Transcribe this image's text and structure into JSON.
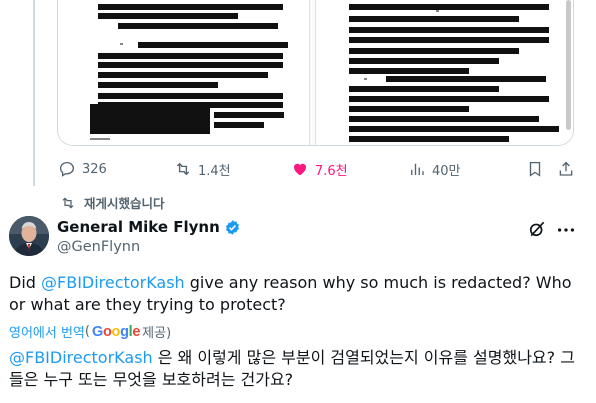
{
  "stats": {
    "replies": "326",
    "reposts": "1.4천",
    "likes": "7.6천",
    "views": "40만"
  },
  "repost_banner": "재게시했습니다",
  "author": {
    "name": "General Mike Flynn",
    "handle": "@GenFlynn"
  },
  "tweet": {
    "mention": "@FBIDirectorKash",
    "before_mention": "Did ",
    "after_mention": " give any reason why so much is redacted? Who or what are they trying to protect?"
  },
  "translation": {
    "link_label": "영어에서 번역",
    "open_paren": "(",
    "provider": "Google",
    "provided_by": " 제공)",
    "mention": "@FBIDirectorKash",
    "text": " 은 왜 이렇게 많은 부분이 검열되었는지 이유를 설명했나요? 그들은 누구 또는 무엇을 보호하려는 건가요?"
  },
  "colors": {
    "accent": "#1d9bf0",
    "like": "#f91880",
    "muted": "#536471",
    "verified": "#1d9bf0"
  },
  "icons": [
    "reply-icon",
    "repost-icon",
    "heart-icon",
    "views-icon",
    "bookmark-icon",
    "share-icon",
    "grok-icon",
    "more-icon",
    "verified-icon"
  ]
}
